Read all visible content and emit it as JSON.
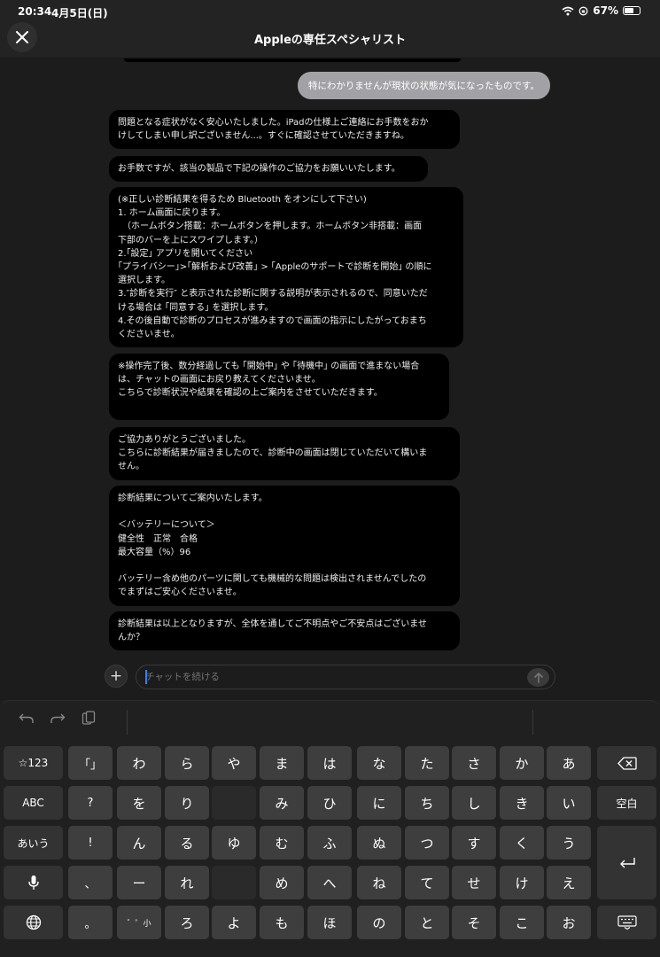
{
  "status_bar": {
    "time": "20:34",
    "date": "4月5日(日)",
    "battery": "67%",
    "battery_level": 0.67
  },
  "header": {
    "title": "Appleの専任スペシャリスト"
  },
  "chat": {
    "user_message": "特にわかりませんが現状の状態が気になったものです。",
    "messages": [
      "問題となる症状がなく安心いたしました。iPadの仕様上ご連絡にお手数をおか\nけしてしまい申し訳ございません...。すぐに確認させていただきますね。",
      "お手数ですが、該当の製品で下記の操作のご協力をお願いいたします。",
      "(※正しい診断結果を得るため Bluetooth をオンにして下さい)\n1. ホーム画面に戻ります。\n　（ホームボタン搭載：ホームボタンを押します。ホームボタン非搭載：画面\n下部のバーを上にスワイプします。）\n2.｢設定｣ アプリを開いてください\n｢プライバシー｣>｢解析および改善｣ > ｢Appleのサポートで診断を開始｣ の順に\n選択します。\n3.″診断を実行″ と表示された診断に関する説明が表示されるので、同意いただ\nける場合は ｢同意する｣ を選択します。\n4.その後自動で診断のプロセスが進みますので画面の指示にしたがっておまち\nくださいませ。",
      "※操作完了後、数分経過しても ｢開始中｣ や ｢待機中｣ の画面で進まない場合\nは、チャットの画面にお戻り教えてくださいませ。\nこちらで診断状況や結果を確認の上ご案内をさせていただきます。\n ",
      "ご協力ありがとうございました。\nこちらに診断結果が届きましたので、診断中の画面は閉じていただいて構いま\nせん。",
      "診断結果についてご案内いたします。\n\n＜バッテリーについて＞\n健全性　正常　合格\n最大容量（%）96\n\nバッテリー含め他のパーツに関しても機械的な問題は検出されませんでしたの\nでまずはご安心くださいませ。",
      "診断結果は以上となりますが、全体を通してご不明点やご不安点はございませ\nんか？"
    ],
    "input_placeholder": "チャットを続ける",
    "plus_label": "+"
  },
  "keyboard": {
    "left_keys": [
      "☆123",
      "ABC",
      "あいう"
    ],
    "punct_keys": [
      "「」",
      "?",
      "!",
      "、",
      "。"
    ],
    "kana_rows": [
      [
        "わ",
        "ら",
        "や",
        "ま",
        "は",
        "な",
        "た",
        "さ",
        "か",
        "あ"
      ],
      [
        "を",
        "り",
        "",
        "み",
        "ひ",
        "に",
        "ち",
        "し",
        "き",
        "い"
      ],
      [
        "ん",
        "る",
        "ゆ",
        "む",
        "ふ",
        "ぬ",
        "つ",
        "す",
        "く",
        "う"
      ],
      [
        "ー",
        "れ",
        "",
        "め",
        "へ",
        "ね",
        "て",
        "せ",
        "け",
        "え"
      ],
      [
        "゛゜小",
        "ろ",
        "よ",
        "も",
        "ほ",
        "の",
        "と",
        "そ",
        "こ",
        "お"
      ]
    ],
    "space_label": "空白"
  }
}
